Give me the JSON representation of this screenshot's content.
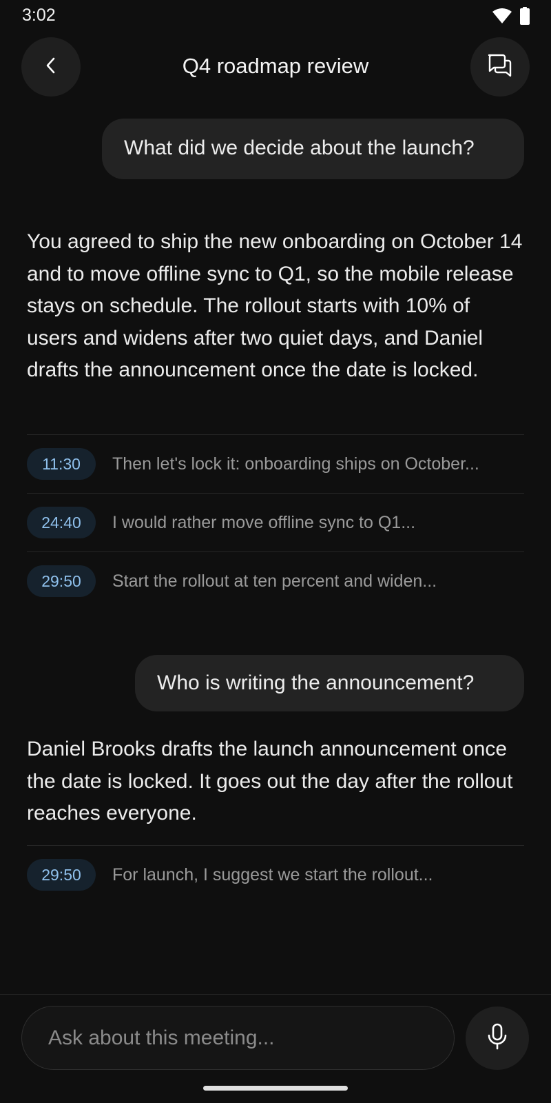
{
  "status_bar": {
    "time": "3:02",
    "icons": [
      "wifi-icon",
      "battery-icon"
    ]
  },
  "header": {
    "title": "Q4 roadmap review",
    "back_icon": "chevron-left-icon",
    "threads_icon": "chat-bubbles-icon"
  },
  "conversation": {
    "exchanges": [
      {
        "question": "What did we decide about the launch?",
        "answer": "You agreed to ship the new onboarding on October 14 and to move offline sync to Q1, so the mobile release stays on schedule. The rollout starts with 10% of users and widens after two quiet days, and Daniel drafts the announcement once the date is locked.",
        "citations": [
          {
            "time": "11:30",
            "text": "Then let's lock it: onboarding ships on October..."
          },
          {
            "time": "24:40",
            "text": "I would rather move offline sync to Q1..."
          },
          {
            "time": "29:50",
            "text": "Start the rollout at ten percent and widen..."
          }
        ]
      },
      {
        "question": "Who is writing the announcement?",
        "answer": "Daniel Brooks drafts the launch announcement once the date is locked. It goes out the day after the rollout reaches everyone.",
        "citations": [
          {
            "time": "29:50",
            "text": "For launch, I suggest we start the rollout..."
          }
        ]
      }
    ]
  },
  "composer": {
    "placeholder": "Ask about this meeting...",
    "mic_icon": "microphone-icon"
  },
  "colors": {
    "background": "#0f0f0f",
    "bubble": "#232323",
    "chip_background": "#16222d",
    "chip_text": "#8fc0ec"
  }
}
